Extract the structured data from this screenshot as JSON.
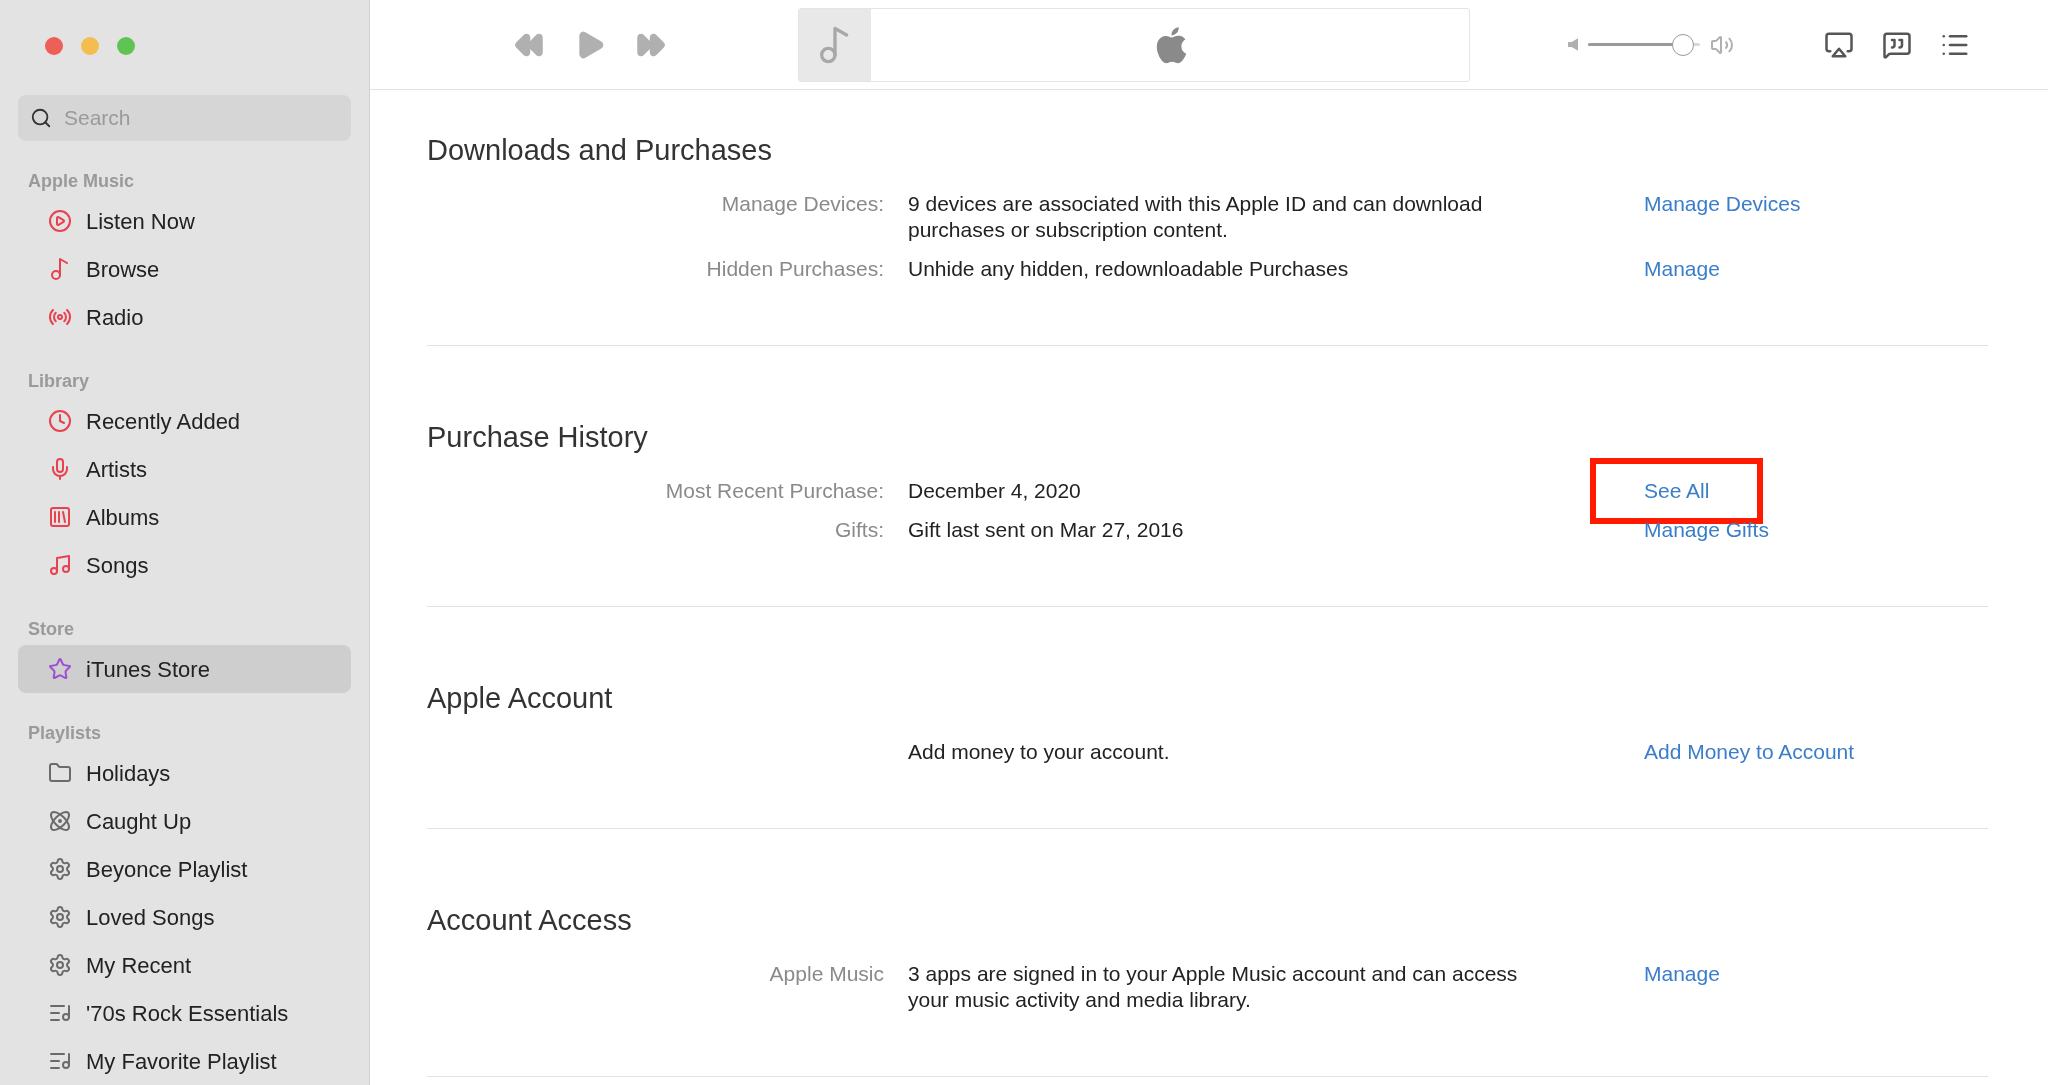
{
  "sidebar": {
    "search": {
      "placeholder": "Search"
    },
    "sections": [
      {
        "title": "Apple Music",
        "items": [
          {
            "label": "Listen Now",
            "kind": "play",
            "selected": false
          },
          {
            "label": "Browse",
            "kind": "note",
            "selected": false
          },
          {
            "label": "Radio",
            "kind": "radio",
            "selected": false
          }
        ]
      },
      {
        "title": "Library",
        "items": [
          {
            "label": "Recently Added",
            "kind": "clock",
            "selected": false
          },
          {
            "label": "Artists",
            "kind": "mic",
            "selected": false
          },
          {
            "label": "Albums",
            "kind": "album",
            "selected": false
          },
          {
            "label": "Songs",
            "kind": "song",
            "selected": false
          }
        ]
      },
      {
        "title": "Store",
        "items": [
          {
            "label": "iTunes Store",
            "kind": "star",
            "selected": true
          }
        ]
      },
      {
        "title": "Playlists",
        "items": [
          {
            "label": "Holidays",
            "kind": "folder",
            "selected": false
          },
          {
            "label": "Caught Up",
            "kind": "atom",
            "selected": false
          },
          {
            "label": "Beyonce Playlist",
            "kind": "gear",
            "selected": false
          },
          {
            "label": "Loved Songs",
            "kind": "gear",
            "selected": false
          },
          {
            "label": "My Recent",
            "kind": "gear",
            "selected": false
          },
          {
            "label": "'70s Rock Essentials",
            "kind": "playlist",
            "selected": false
          },
          {
            "label": "My Favorite Playlist",
            "kind": "playlist",
            "selected": false
          }
        ]
      }
    ]
  },
  "toolbar": {
    "volume": {
      "level": 0.85
    }
  },
  "sections": [
    {
      "title": "Downloads and Purchases",
      "rows": [
        {
          "label": "Manage Devices:",
          "value": "9 devices are associated with this Apple ID and can download purchases or subscription content.",
          "link": "Manage Devices",
          "highlighted": false
        },
        {
          "label": "Hidden Purchases:",
          "value": "Unhide any hidden, redownloadable Purchases",
          "link": "Manage",
          "highlighted": false
        }
      ]
    },
    {
      "title": "Purchase History",
      "rows": [
        {
          "label": "Most Recent Purchase:",
          "value": "December 4, 2020",
          "link": "See All",
          "highlighted": true
        },
        {
          "label": "Gifts:",
          "value": "Gift last sent on Mar 27, 2016",
          "link": "Manage Gifts",
          "highlighted": false
        }
      ]
    },
    {
      "title": "Apple Account",
      "rows": [
        {
          "value": "Add money to your account.",
          "link": "Add Money to Account",
          "highlighted": false
        }
      ]
    },
    {
      "title": "Account Access",
      "rows": [
        {
          "label": "Apple Music",
          "value": "3 apps are signed in to your Apple Music account and can access your music activity and media library.",
          "link": "Manage",
          "highlighted": false
        }
      ]
    }
  ]
}
